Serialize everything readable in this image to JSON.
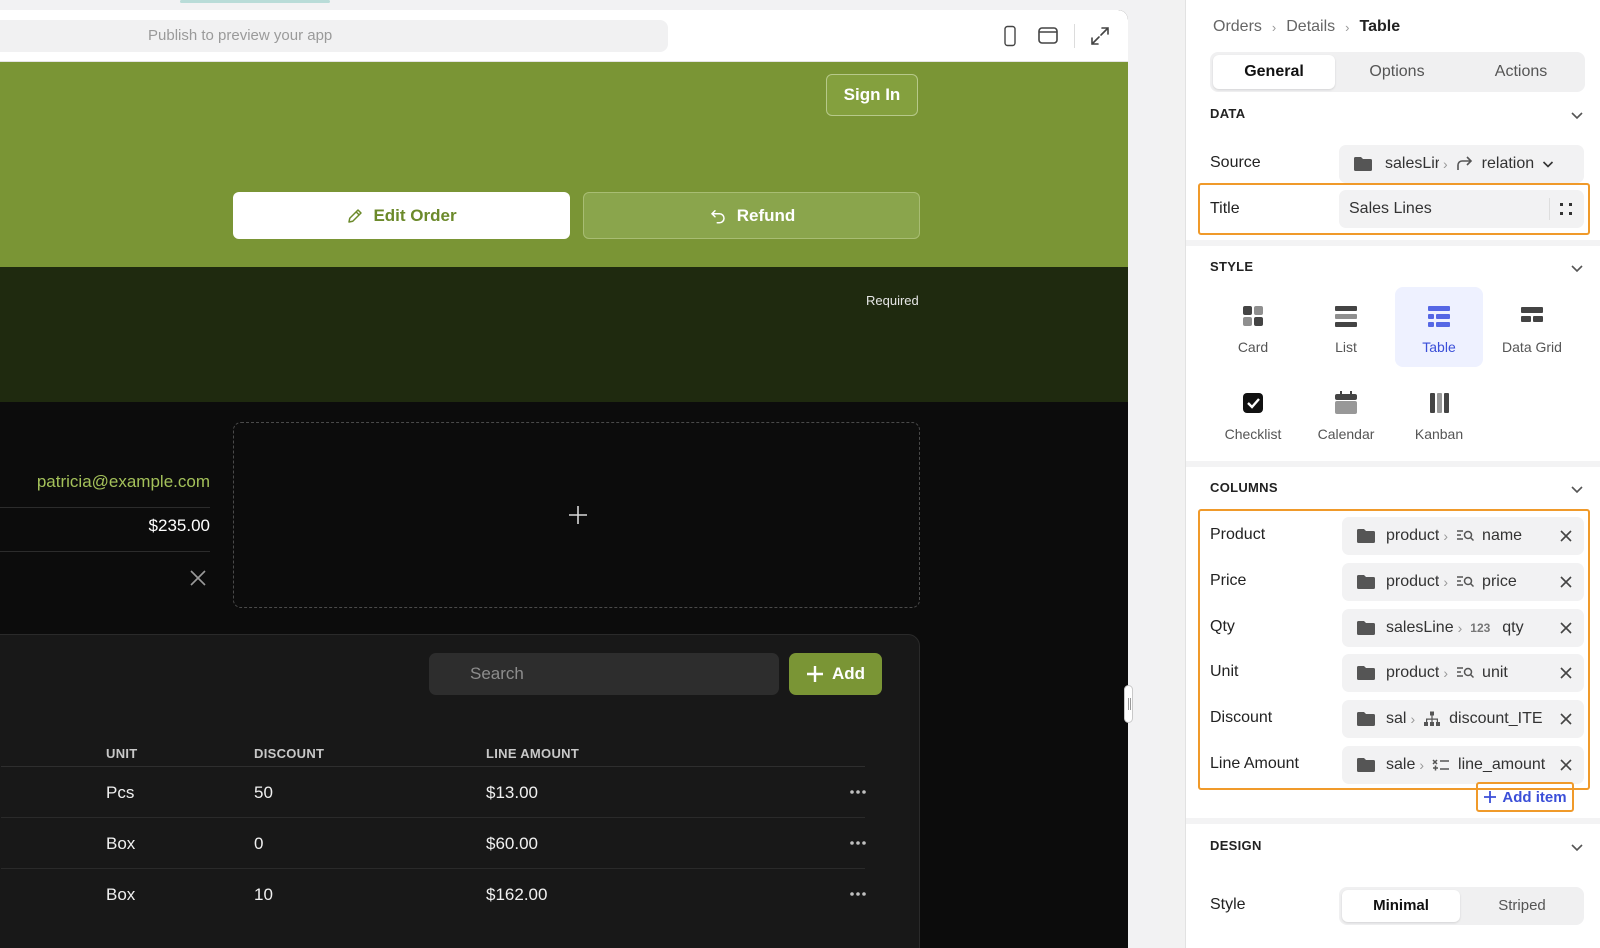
{
  "preview": {
    "url_placeholder": "Publish to preview your app",
    "sign_in_label": "Sign In",
    "edit_order_label": "Edit Order",
    "refund_label": "Refund",
    "required_text": "Required",
    "customer_email": "patricia@example.com",
    "order_amount": "$235.00",
    "search_placeholder": "Search",
    "add_label": "Add",
    "table": {
      "headers": [
        "UNIT",
        "DISCOUNT",
        "LINE AMOUNT"
      ],
      "rows": [
        {
          "unit": "Pcs",
          "discount": "50",
          "line_amount": "$13.00"
        },
        {
          "unit": "Box",
          "discount": "0",
          "line_amount": "$60.00"
        },
        {
          "unit": "Box",
          "discount": "10",
          "line_amount": "$162.00"
        }
      ]
    },
    "colors": {
      "brand_green": "#7a9535",
      "dark_band": "#1f2a0f",
      "link_green": "#a4c15a"
    }
  },
  "inspector": {
    "breadcrumb": [
      "Orders",
      "Details",
      "Table"
    ],
    "tabs": [
      "General",
      "Options",
      "Actions"
    ],
    "active_tab": "General",
    "data": {
      "section_title": "DATA",
      "source_label": "Source",
      "source_path": "salesLir",
      "source_relation": "relation",
      "title_label": "Title",
      "title_value": "Sales Lines"
    },
    "style": {
      "section_title": "STYLE",
      "options": [
        "Card",
        "List",
        "Table",
        "Data Grid",
        "Checklist",
        "Calendar",
        "Kanban"
      ],
      "selected": "Table"
    },
    "columns": {
      "section_title": "COLUMNS",
      "items": [
        {
          "label": "Product",
          "path": "product",
          "type_icon": "lookup-icon",
          "field": "name"
        },
        {
          "label": "Price",
          "path": "product",
          "type_icon": "lookup-icon",
          "field": "price"
        },
        {
          "label": "Qty",
          "path": "salesLine",
          "type_icon": "123",
          "field": "qty"
        },
        {
          "label": "Unit",
          "path": "product",
          "type_icon": "lookup-icon",
          "field": "unit"
        },
        {
          "label": "Discount",
          "path": "sal",
          "type_icon": "hierarchy-icon",
          "field": "discount_ITE"
        },
        {
          "label": "Line Amount",
          "path": "sale",
          "type_icon": "formula-icon",
          "field": "line_amount"
        }
      ],
      "add_item_label": "Add item"
    },
    "design": {
      "section_title": "DESIGN",
      "style_label": "Style",
      "options": [
        "Minimal",
        "Striped"
      ],
      "selected": "Minimal"
    },
    "colors": {
      "highlight_orange": "#f09a2a",
      "accent_blue": "#3b4fd8"
    }
  }
}
